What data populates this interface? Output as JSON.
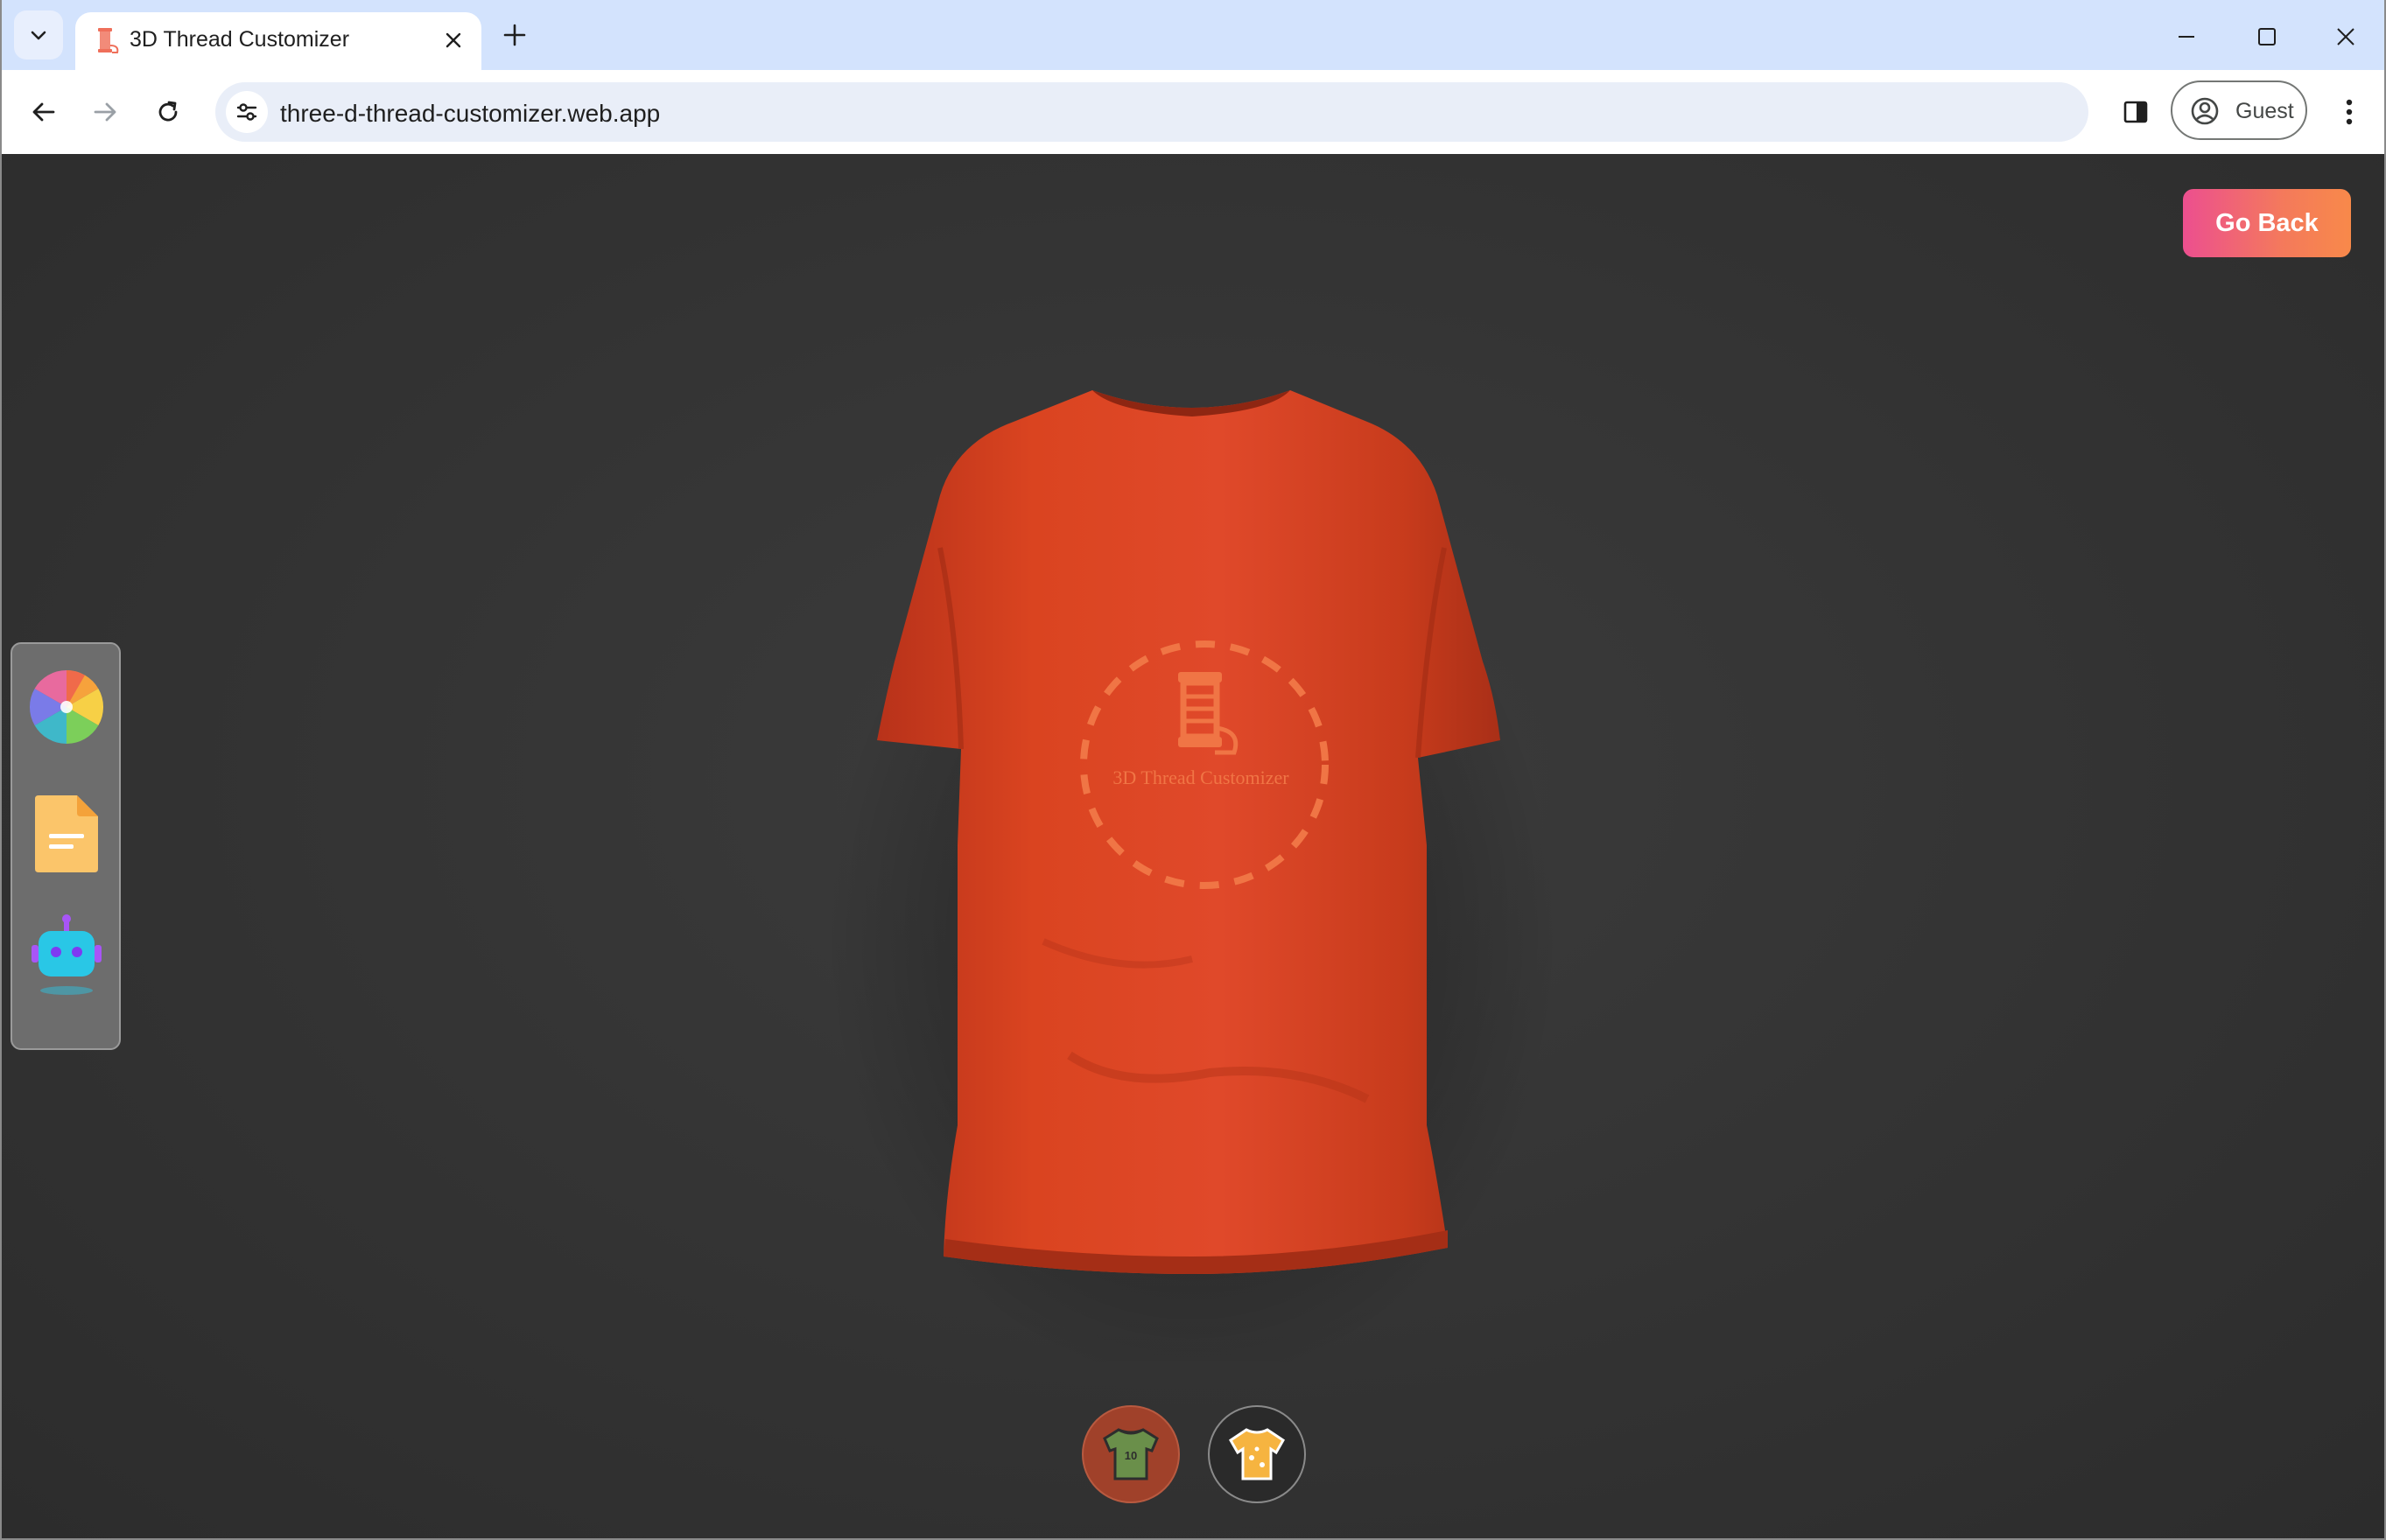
{
  "browser": {
    "tab_title": "3D Thread Customizer",
    "url": "three-d-thread-customizer.web.app",
    "profile_label": "Guest"
  },
  "page": {
    "go_back_label": "Go Back",
    "shirt_color": "#d9431f",
    "logo_text": "3D Thread Customizer",
    "tools": [
      "color-picker-icon",
      "file-picker-icon",
      "ai-picker-icon"
    ],
    "filter_tabs": [
      "logo-shirt-icon",
      "stylish-shirt-icon"
    ],
    "filter_logo_number": "10"
  },
  "colors": {
    "accent_gradient_start": "#ec4f8f",
    "accent_gradient_end": "#f8894a",
    "background": "#333333",
    "tab_strip": "#d3e3fd"
  }
}
